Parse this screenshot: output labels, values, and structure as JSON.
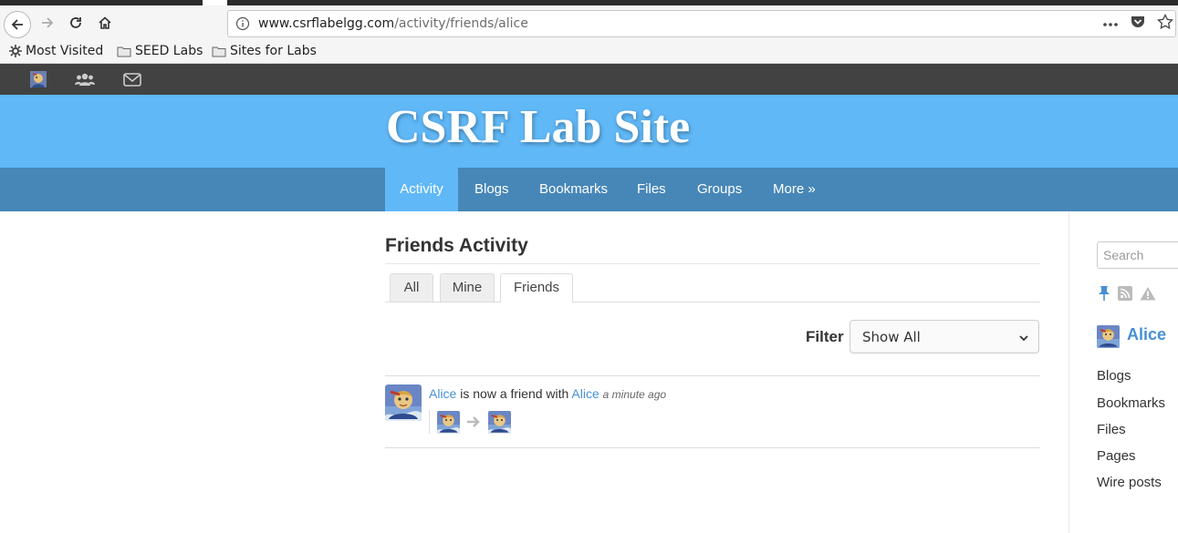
{
  "browser": {
    "url_host": "www.csrflabelgg.com",
    "url_path": "/activity/friends/alice",
    "bookmarks": [
      {
        "label": "Most Visited",
        "icon": "gear-icon"
      },
      {
        "label": "SEED Labs",
        "icon": "folder-icon"
      },
      {
        "label": "Sites for Labs",
        "icon": "folder-icon"
      }
    ]
  },
  "site": {
    "title": "CSRF Lab Site",
    "menu": [
      "Activity",
      "Blogs",
      "Bookmarks",
      "Files",
      "Groups",
      "More »"
    ],
    "active_menu": "Activity"
  },
  "main": {
    "page_title": "Friends Activity",
    "tabs": [
      "All",
      "Mine",
      "Friends"
    ],
    "selected_tab": "Friends",
    "filter_label": "Filter",
    "filter_value": "Show All",
    "river": {
      "subject": "Alice",
      "action": " is now a friend with ",
      "object": "Alice",
      "time": "a minute ago"
    }
  },
  "sidebar": {
    "search_placeholder": "Search",
    "owner_name": "Alice",
    "links": [
      "Blogs",
      "Bookmarks",
      "Files",
      "Pages",
      "Wire posts"
    ]
  },
  "colors": {
    "header": "#60b8f7",
    "menu": "#4787b8",
    "topbar": "#424242",
    "link": "#4690d6"
  }
}
